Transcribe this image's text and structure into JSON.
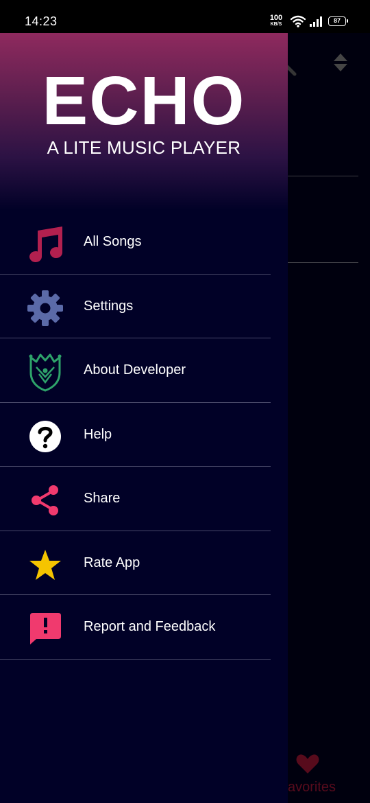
{
  "status_bar": {
    "time": "14:23",
    "net_speed_value": "100",
    "net_speed_unit": "KB/S",
    "battery": "87"
  },
  "drawer": {
    "title": "ECHO",
    "subtitle": "A LITE MUSIC PLAYER",
    "items": [
      {
        "label": "All Songs",
        "icon": "music-note-icon",
        "color": "#b2204f"
      },
      {
        "label": "Settings",
        "icon": "gear-icon",
        "color": "#5b6aa8"
      },
      {
        "label": "About Developer",
        "icon": "shield-crest-icon",
        "color": "#2ea36a"
      },
      {
        "label": "Help",
        "icon": "question-icon",
        "color": "#ffffff"
      },
      {
        "label": "Share",
        "icon": "share-icon",
        "color": "#f03a6e"
      },
      {
        "label": "Rate App",
        "icon": "star-icon",
        "color": "#f5c400"
      },
      {
        "label": "Report and Feedback",
        "icon": "feedback-icon",
        "color": "#f03a6e"
      }
    ]
  },
  "background": {
    "favorites_label": "avorites"
  },
  "colors": {
    "drawer_bg": "#010127",
    "header_top": "#8f2a5e",
    "accent": "#c0193f"
  }
}
